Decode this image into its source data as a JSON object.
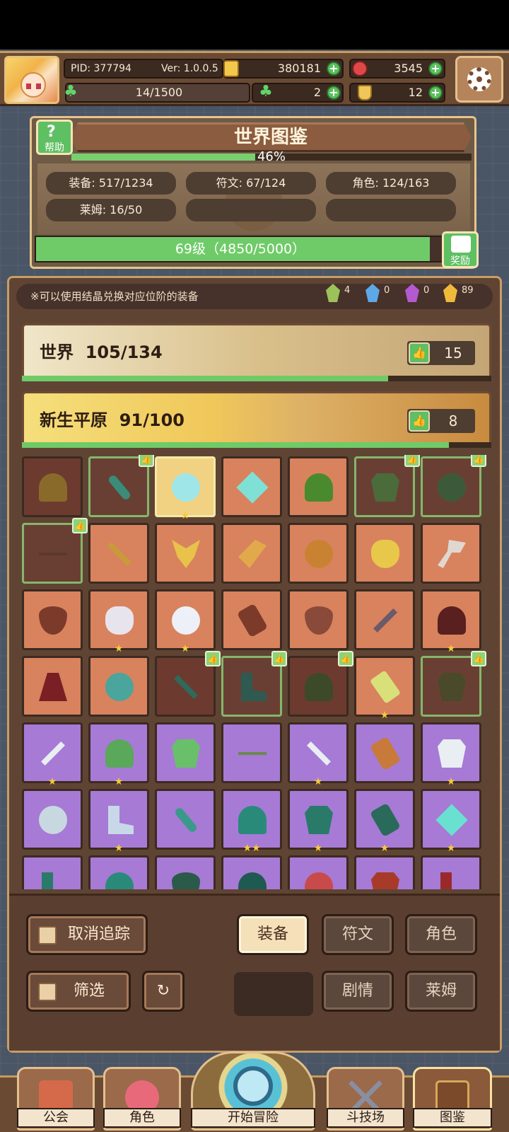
{
  "topbar": {
    "pid": "PID: 377794",
    "version": "Ver: 1.0.0.5",
    "gold": "380181",
    "red_gems": "3545",
    "stamina": "14/1500",
    "clover": "2",
    "bottle": "12"
  },
  "catalog": {
    "title": "世界图鉴",
    "help_label": "帮助",
    "percent": "46%",
    "percent_value": 0.46,
    "stats": [
      "装备: 517/1234",
      "符文: 67/124",
      "角色: 124/163",
      "莱姆: 16/50"
    ],
    "level_text": "69级（4850/5000）",
    "level_progress": 0.97,
    "reward_label": "奖励"
  },
  "main": {
    "tip": "※可以使用结晶兑换对应位阶的装备",
    "crystals": [
      {
        "color": "#9cc25a",
        "count": "4"
      },
      {
        "color": "#5fa8e8",
        "count": "0"
      },
      {
        "color": "#b45ad0",
        "count": "0"
      },
      {
        "color": "#f0b93a",
        "count": "89"
      }
    ],
    "world": {
      "name": "世界",
      "count": "105/134",
      "badge": "15",
      "progress": 0.78
    },
    "plain": {
      "name": "新生平原",
      "count": "91/100",
      "badge": "8",
      "progress": 0.91
    }
  },
  "items": [
    {
      "bg": "dark",
      "icon": "hat",
      "color": "#8a6a2a",
      "stars": "",
      "thumb": false
    },
    {
      "bg": "dkgreen",
      "icon": "staff",
      "color": "#3a8c7a",
      "stars": "",
      "thumb": true
    },
    {
      "bg": "gold",
      "icon": "orb",
      "color": "#9fe6e8",
      "stars": "★",
      "thumb": false
    },
    {
      "bg": "orange",
      "icon": "gem",
      "color": "#7fe0d6",
      "stars": "",
      "thumb": false
    },
    {
      "bg": "orange",
      "icon": "hood",
      "color": "#4a8a2e",
      "stars": "",
      "thumb": false
    },
    {
      "bg": "dkgreen",
      "icon": "armor",
      "color": "#4c6b3a",
      "stars": "",
      "thumb": true
    },
    {
      "bg": "dkgreen",
      "icon": "ring",
      "color": "#3c5a3a",
      "stars": "",
      "thumb": true
    },
    {
      "bg": "dkgreen",
      "icon": "crossbow",
      "color": "#5a3a2a",
      "stars": "",
      "thumb": true
    },
    {
      "bg": "orange",
      "icon": "arrow",
      "color": "#c99a3a",
      "stars": "",
      "thumb": false
    },
    {
      "bg": "orange",
      "icon": "amulet",
      "color": "#e8c24a",
      "stars": "",
      "thumb": false
    },
    {
      "bg": "orange",
      "icon": "horn",
      "color": "#e2a94a",
      "stars": "",
      "thumb": false
    },
    {
      "bg": "orange",
      "icon": "ring",
      "color": "#c98232",
      "stars": "",
      "thumb": false
    },
    {
      "bg": "orange",
      "icon": "ring-gem",
      "color": "#e8c84a",
      "stars": "",
      "thumb": false
    },
    {
      "bg": "orange",
      "icon": "axe",
      "color": "#e0d8d0",
      "stars": "",
      "thumb": false
    },
    {
      "bg": "orange",
      "icon": "necklace",
      "color": "#7c3a2a",
      "stars": "",
      "thumb": false
    },
    {
      "bg": "orange",
      "icon": "pot",
      "color": "#e8e4ee",
      "stars": "★",
      "thumb": false
    },
    {
      "bg": "orange",
      "icon": "orb",
      "color": "#eef0f8",
      "stars": "★",
      "thumb": false
    },
    {
      "bg": "orange",
      "icon": "gauntlet",
      "color": "#7c3a2a",
      "stars": "",
      "thumb": false
    },
    {
      "bg": "orange",
      "icon": "necklace",
      "color": "#8a4a3a",
      "stars": "",
      "thumb": false
    },
    {
      "bg": "orange",
      "icon": "sword",
      "color": "#6a5a6a",
      "stars": "",
      "thumb": false
    },
    {
      "bg": "orange",
      "icon": "hood",
      "color": "#5a1f1f",
      "stars": "★",
      "thumb": false
    },
    {
      "bg": "orange",
      "icon": "cape",
      "color": "#7a1f24",
      "stars": "",
      "thumb": false
    },
    {
      "bg": "orange",
      "icon": "bow",
      "color": "#4aa59c",
      "stars": "",
      "thumb": false
    },
    {
      "bg": "dark",
      "icon": "arrow",
      "color": "#2f6a5a",
      "stars": "",
      "thumb": true
    },
    {
      "bg": "dkgreen",
      "icon": "boots",
      "color": "#2f5a52",
      "stars": "",
      "thumb": true
    },
    {
      "bg": "dark",
      "icon": "hood",
      "color": "#3c4a2a",
      "stars": "",
      "thumb": true
    },
    {
      "bg": "orange",
      "icon": "scroll",
      "color": "#d9e07a",
      "stars": "★",
      "thumb": false
    },
    {
      "bg": "dkgreen",
      "icon": "armor",
      "color": "#4a4a2a",
      "stars": "",
      "thumb": true
    },
    {
      "bg": "purple",
      "icon": "sword",
      "color": "#e8eef2",
      "stars": "★",
      "thumb": false
    },
    {
      "bg": "purple",
      "icon": "hood",
      "color": "#5aa85a",
      "stars": "★",
      "thumb": false
    },
    {
      "bg": "purple",
      "icon": "armor",
      "color": "#6abf6a",
      "stars": "",
      "thumb": false
    },
    {
      "bg": "purple",
      "icon": "crossbow",
      "color": "#6a8a4a",
      "stars": "",
      "thumb": false
    },
    {
      "bg": "purple",
      "icon": "arrow",
      "color": "#e8eef2",
      "stars": "★",
      "thumb": false
    },
    {
      "bg": "purple",
      "icon": "gauntlet",
      "color": "#c87a3a",
      "stars": "",
      "thumb": false
    },
    {
      "bg": "purple",
      "icon": "armor",
      "color": "#e8eef2",
      "stars": "★",
      "thumb": false
    },
    {
      "bg": "purple",
      "icon": "ring",
      "color": "#c8d8e0",
      "stars": "",
      "thumb": false
    },
    {
      "bg": "purple",
      "icon": "boots",
      "color": "#c8d8e8",
      "stars": "★",
      "thumb": false
    },
    {
      "bg": "purple",
      "icon": "staff",
      "color": "#3a9a8a",
      "stars": "",
      "thumb": false
    },
    {
      "bg": "purple",
      "icon": "hat",
      "color": "#2a8a7a",
      "stars": "★★",
      "thumb": false
    },
    {
      "bg": "purple",
      "icon": "armor",
      "color": "#2a7a6a",
      "stars": "★",
      "thumb": false
    },
    {
      "bg": "purple",
      "icon": "gauntlet",
      "color": "#2a6a5a",
      "stars": "★",
      "thumb": false
    },
    {
      "bg": "purple",
      "icon": "gem",
      "color": "#6ae0d0",
      "stars": "★",
      "thumb": false
    },
    {
      "bg": "purple",
      "icon": "boots",
      "color": "#2a7a6a",
      "stars": "",
      "thumb": false
    },
    {
      "bg": "purple",
      "icon": "hat",
      "color": "#2a8a7a",
      "stars": "",
      "thumb": false
    },
    {
      "bg": "purple",
      "icon": "necklace",
      "color": "#2a5a4a",
      "stars": "",
      "thumb": false
    },
    {
      "bg": "purple",
      "icon": "hood",
      "color": "#1f5a52",
      "stars": "",
      "thumb": false
    },
    {
      "bg": "purple",
      "icon": "orb",
      "color": "#c84a4a",
      "stars": "",
      "thumb": false
    },
    {
      "bg": "purple",
      "icon": "armor",
      "color": "#a83a2a",
      "stars": "",
      "thumb": false
    },
    {
      "bg": "purple",
      "icon": "boots",
      "color": "#9a2a2a",
      "stars": "",
      "thumb": false
    }
  ],
  "controls": {
    "untrack": "取消追踪",
    "filter": "筛选",
    "tab_equipment": "装备",
    "tab_rune": "符文",
    "tab_character": "角色",
    "tab_story": "剧情",
    "tab_slime": "莱姆"
  },
  "nav": {
    "guild": "公会",
    "character": "角色",
    "adventure": "开始冒险",
    "arena": "斗技场",
    "catalog": "图鉴"
  }
}
